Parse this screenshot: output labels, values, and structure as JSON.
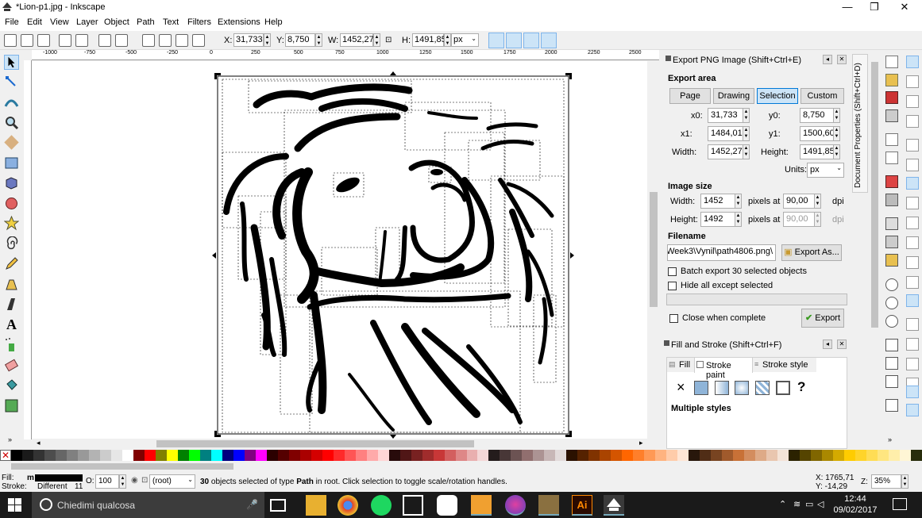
{
  "window": {
    "title": "*Lion-p1.jpg - Inkscape",
    "minimize": "—",
    "restore": "❐",
    "close": "✕"
  },
  "menu": [
    "File",
    "Edit",
    "View",
    "Layer",
    "Object",
    "Path",
    "Text",
    "Filters",
    "Extensions",
    "Help"
  ],
  "toolbar": {
    "x_label": "X:",
    "x_value": "31,733",
    "y_label": "Y:",
    "y_value": "8,750",
    "w_label": "W:",
    "w_value": "1452,27",
    "h_label": "H:",
    "h_value": "1491,85",
    "unit": "px"
  },
  "ruler_top": [
    "-1000",
    "-750",
    "-500",
    "-250",
    "0",
    "250",
    "500",
    "750",
    "1000",
    "1250",
    "1500",
    "1750",
    "2000",
    "2250",
    "2500"
  ],
  "export_png": {
    "title": "Export PNG Image (Shift+Ctrl+E)",
    "export_area_label": "Export area",
    "area_buttons": [
      "Page",
      "Drawing",
      "Selection",
      "Custom"
    ],
    "x0_label": "x0:",
    "x0": "31,733",
    "y0_label": "y0:",
    "y0": "8,750",
    "x1_label": "x1:",
    "x1": "1484,012",
    "y1_label": "y1:",
    "y1": "1500,606",
    "width_label": "Width:",
    "width": "1452,278",
    "height_label": "Height:",
    "height": "1491,856",
    "units_label": "Units:",
    "units": "px",
    "image_size_label": "Image size",
    "img_width_label": "Width:",
    "img_width": "1452",
    "img_height_label": "Height:",
    "img_height": "1492",
    "pixels_at": "pixels at",
    "dpi1": "90,00",
    "dpi2": "90,00",
    "dpi_unit": "dpi",
    "filename_label": "Filename",
    "filename": "\\Week3\\Vynil\\path4806.png",
    "export_as": "Export As...",
    "batch_export": "Batch export 30 selected objects",
    "hide_all": "Hide all except selected",
    "close_when_complete": "Close when complete",
    "export_button": "Export"
  },
  "doc_properties_tab": "Document Properties (Shift+Ctrl+D)",
  "fill_stroke": {
    "title": "Fill and Stroke (Shift+Ctrl+F)",
    "tabs": [
      "Fill",
      "Stroke paint",
      "Stroke style"
    ],
    "x_mark": "×",
    "question": "?",
    "multiple_styles": "Multiple styles"
  },
  "status": {
    "fill_label": "Fill:",
    "fill_value": "m",
    "stroke_label": "Stroke:",
    "stroke_value": "Different",
    "stroke_width": "11",
    "opacity_label": "O:",
    "opacity": "100",
    "layer": "(root)",
    "message_count": "30",
    "message": " objects selected of type ",
    "message_type": "Path",
    "message_tail": " in root. Click selection to toggle scale/rotation handles.",
    "coord_x": "X: 1765,71",
    "coord_y": "Y:  -14,29",
    "zoom_label": "Z:",
    "zoom": "35%"
  },
  "taskbar": {
    "search": "Chiedimi qualcosa",
    "time": "12:44",
    "date": "09/02/2017"
  },
  "palette": [
    "#000000",
    "#1a1a1a",
    "#333333",
    "#4d4d4d",
    "#666666",
    "#808080",
    "#999999",
    "#b3b3b3",
    "#cccccc",
    "#e6e6e6",
    "#ffffff",
    "#800000",
    "#ff0000",
    "#808000",
    "#ffff00",
    "#008000",
    "#00ff00",
    "#008080",
    "#00ffff",
    "#000080",
    "#0000ff",
    "#800080",
    "#ff00ff",
    "#2b0000",
    "#550000",
    "#800000",
    "#aa0000",
    "#d40000",
    "#ff0000",
    "#ff2a2a",
    "#ff5555",
    "#ff8080",
    "#ffaaaa",
    "#ffd5d5",
    "#280b0b",
    "#501616",
    "#782121",
    "#a02c2c",
    "#c83737",
    "#d35f5f",
    "#de8787",
    "#e9afaf",
    "#f4d7d7",
    "#241c1c",
    "#483737",
    "#6c5353",
    "#916f6f",
    "#ac9393",
    "#c8b7b7",
    "#e3dbdb",
    "#2b1100",
    "#552200",
    "#803300",
    "#aa4400",
    "#d45500",
    "#ff6600",
    "#ff7f2a",
    "#ff9955",
    "#ffb380",
    "#ffccaa",
    "#ffe6d5",
    "#28170b",
    "#502d16",
    "#784421",
    "#a05a2c",
    "#c87137",
    "#d38d5f",
    "#deaa87",
    "#e9c6af",
    "#f4e3d7",
    "#2b2200",
    "#554400",
    "#806600",
    "#aa8800",
    "#d4aa00",
    "#ffcc00",
    "#ffd42a",
    "#ffdd55",
    "#ffe680",
    "#ffeeaa",
    "#fff6d5",
    "#282d0b"
  ]
}
